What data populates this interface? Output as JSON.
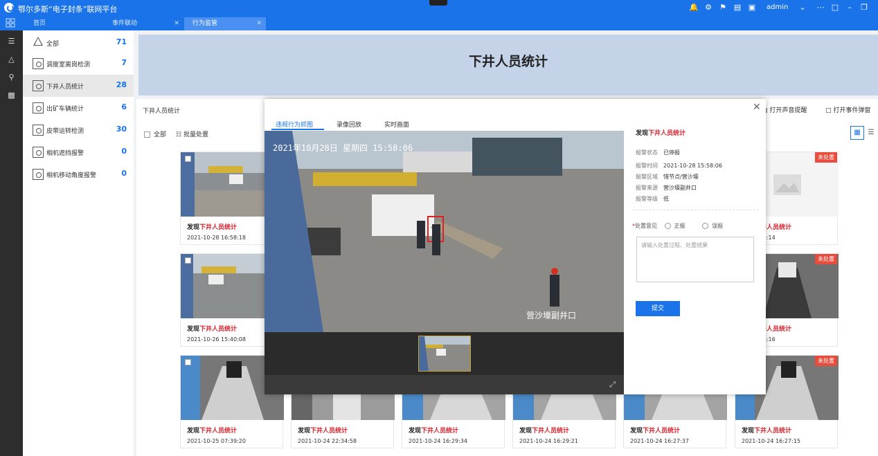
{
  "app": {
    "title": "鄂尔多斯“电子封条”联网平台",
    "user": "admin",
    "accent": "#1a73e8"
  },
  "tabs": [
    {
      "label": "首页"
    },
    {
      "label": "事件联动"
    },
    {
      "label": "行为监管"
    }
  ],
  "categories": [
    {
      "label": "全部",
      "count": "71",
      "icon": "warning-icon"
    },
    {
      "label": "调度室离岗检测",
      "count": "7",
      "icon": "camera-frame-icon"
    },
    {
      "label": "下井人员统计",
      "count": "28",
      "icon": "camera-frame-icon"
    },
    {
      "label": "出矿车辆统计",
      "count": "6",
      "icon": "camera-frame-icon"
    },
    {
      "label": "皮带运转检测",
      "count": "30",
      "icon": "camera-frame-icon"
    },
    {
      "label": "相机遮挡报警",
      "count": "0",
      "icon": "camera-frame-icon"
    },
    {
      "label": "相机移动角度报警",
      "count": "0",
      "icon": "camera-frame-icon"
    }
  ],
  "main": {
    "banner_title": "下井人员统计",
    "section_title": "下井人员统计",
    "select_all": "全部",
    "batch": "批量处置",
    "sound_alert": "打开声音提醒",
    "event_popup": "打开事件弹窗"
  },
  "cards": {
    "prefix": "发现",
    "event": "下井人员统计",
    "unhandled": "未处置",
    "dates": [
      "2021-10-28 16:58:18",
      "27 10:42:14",
      "2021-10-26 15:40:08",
      "25 08:38:16",
      "2021-10-25 07:39:20",
      "2021-10-24 22:34:58",
      "2021-10-24 16:29:34",
      "2021-10-24 16:29:21",
      "2021-10-24 16:27:37",
      "2021-10-24 16:27:15"
    ]
  },
  "modal": {
    "tabs": [
      "违规行为抓图",
      "录像回放",
      "实时画面"
    ],
    "video_timestamp": "2021年10月28日 星期四 15:58:06",
    "video_location": "营沙壕副井口",
    "detail": {
      "prefix": "发现",
      "event": "下井人员统计",
      "rows": [
        {
          "k": "报警状态",
          "v": "已停报"
        },
        {
          "k": "报警时间",
          "v": "2021-10-28 15:58:06"
        },
        {
          "k": "报警区域",
          "v": "惜节点/营沙壕"
        },
        {
          "k": "报警来源",
          "v": "营沙壕副井口"
        },
        {
          "k": "报警等级",
          "v": "低"
        }
      ],
      "dispose_label": "处置意见",
      "options": [
        "正报",
        "误报"
      ],
      "remark_placeholder": "请输入处置过程、处置结果",
      "submit": "提交"
    }
  }
}
